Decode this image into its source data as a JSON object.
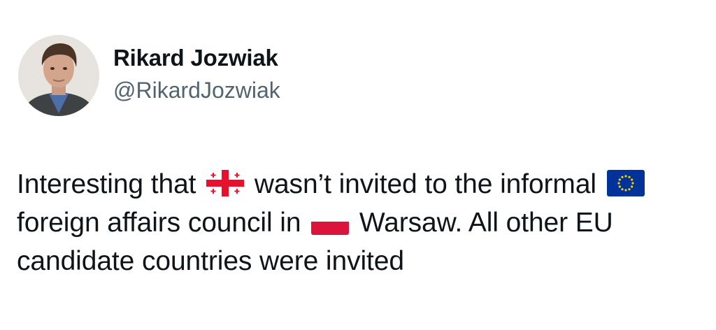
{
  "author": {
    "display_name": "Rikard Jozwiak",
    "handle": "@RikardJozwiak",
    "avatar_icon": "profile-photo"
  },
  "tweet": {
    "text_1": "Interesting that",
    "flag_1": "georgia-flag-icon",
    "text_2": "wasn’t invited to the informal",
    "flag_2": "eu-flag-icon",
    "text_3": "foreign affairs council in",
    "flag_3": "poland-flag-icon",
    "text_4": "Warsaw. All other EU candidate countries were invited"
  },
  "colors": {
    "text": "#0f1419",
    "secondary_text": "#536471",
    "background": "#ffffff"
  }
}
